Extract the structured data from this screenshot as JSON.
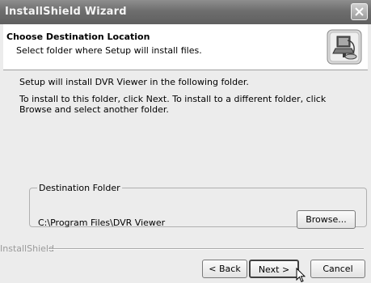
{
  "window": {
    "title": "InstallShield Wizard"
  },
  "header": {
    "title": "Choose Destination Location",
    "subtitle": "Select folder where Setup will install files."
  },
  "content": {
    "line1": "Setup will install DVR Viewer in the following folder.",
    "line2": "To install to this folder, click Next. To install to a different folder, click Browse and select another folder."
  },
  "destination": {
    "group_label": "Destination Folder",
    "path": "C:\\Program Files\\DVR Viewer",
    "browse_label": "Browse..."
  },
  "footer": {
    "brand": "InstallShield",
    "back_label": "< Back",
    "next_label": "Next >",
    "cancel_label": "Cancel"
  },
  "icons": {
    "header_icon": "computer-install-icon",
    "close": "close-icon",
    "cursor": "mouse-pointer-icon"
  }
}
